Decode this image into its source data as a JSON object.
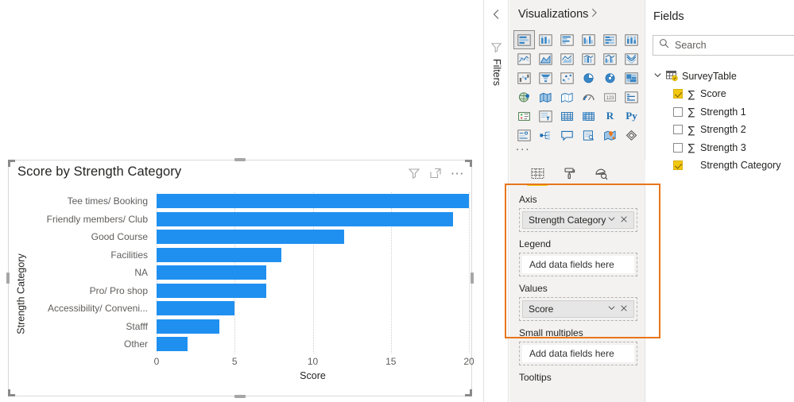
{
  "visual": {
    "title": "Score by Strength Category",
    "header_icons": [
      "filter-icon",
      "focus-mode-icon",
      "more-options-icon"
    ]
  },
  "chart_data": {
    "type": "bar",
    "orientation": "horizontal",
    "title": "Score by Strength Category",
    "xlabel": "Score",
    "ylabel": "Strength Category",
    "categories": [
      "Tee times/ Booking",
      "Friendly members/ Club",
      "Good Course",
      "Facilities",
      "NA",
      "Pro/ Pro shop",
      "Accessibility/ Conveni...",
      "Stafff",
      "Other"
    ],
    "values": [
      20,
      19,
      12,
      8,
      7,
      7,
      5,
      4,
      2
    ],
    "xticks": [
      0,
      5,
      10,
      15,
      20
    ],
    "xlim": [
      0,
      20
    ],
    "grid": true,
    "legend": "none",
    "bar_color": "#1f90f0"
  },
  "filters_rail": {
    "collapse_label": "chevron-left-icon",
    "funnel_label": "funnel-icon",
    "label": "Filters"
  },
  "visualizations": {
    "title": "Visualizations",
    "expand_icon": "chevron-right-icon",
    "more_label": "...",
    "icons": [
      "stacked-bar-chart-icon",
      "stacked-column-chart-icon",
      "clustered-bar-chart-icon",
      "clustered-column-chart-icon",
      "100-stacked-bar-chart-icon",
      "100-stacked-column-chart-icon",
      "line-chart-icon",
      "area-chart-icon",
      "stacked-area-chart-icon",
      "line-stacked-column-chart-icon",
      "line-clustered-column-chart-icon",
      "ribbon-chart-icon",
      "waterfall-chart-icon",
      "funnel-chart-icon",
      "scatter-chart-icon",
      "pie-chart-icon",
      "donut-chart-icon",
      "treemap-icon",
      "map-icon",
      "filled-map-icon",
      "shape-map-icon",
      "gauge-icon",
      "card-icon",
      "multi-row-card-icon",
      "kpi-icon",
      "slicer-icon",
      "table-icon",
      "matrix-icon",
      "r-script-visual-icon",
      "python-visual-icon",
      "key-influencers-icon",
      "decomposition-tree-icon",
      "q-and-a-icon",
      "smart-narrative-icon",
      "arcgis-map-icon",
      "paginated-report-icon"
    ],
    "tabs": [
      {
        "name": "fields-tab",
        "icon": "fields-grid-icon",
        "active": true
      },
      {
        "name": "format-tab",
        "icon": "paint-roller-icon",
        "active": false
      },
      {
        "name": "analytics-tab",
        "icon": "magnifier-icon",
        "active": false
      }
    ],
    "wells": [
      {
        "label": "Axis",
        "value": "Strength Category",
        "empty": false
      },
      {
        "label": "Legend",
        "value": "Add data fields here",
        "empty": true
      },
      {
        "label": "Values",
        "value": "Score",
        "empty": false
      },
      {
        "label": "Small multiples",
        "value": "Add data fields here",
        "empty": true
      },
      {
        "label": "Tooltips",
        "value": "",
        "empty": true
      }
    ],
    "highlight_color": "#e8751a"
  },
  "fields": {
    "title": "Fields",
    "search_placeholder": "Search",
    "search_value": "",
    "search_icon": "search-icon",
    "table": {
      "name": "SurveyTable",
      "expanded": true
    },
    "items": [
      {
        "label": "Score",
        "checked": true,
        "aggregate": true
      },
      {
        "label": "Strength 1",
        "checked": false,
        "aggregate": true
      },
      {
        "label": "Strength 2",
        "checked": false,
        "aggregate": true
      },
      {
        "label": "Strength 3",
        "checked": false,
        "aggregate": true
      },
      {
        "label": "Strength Category",
        "checked": true,
        "aggregate": false
      }
    ]
  }
}
